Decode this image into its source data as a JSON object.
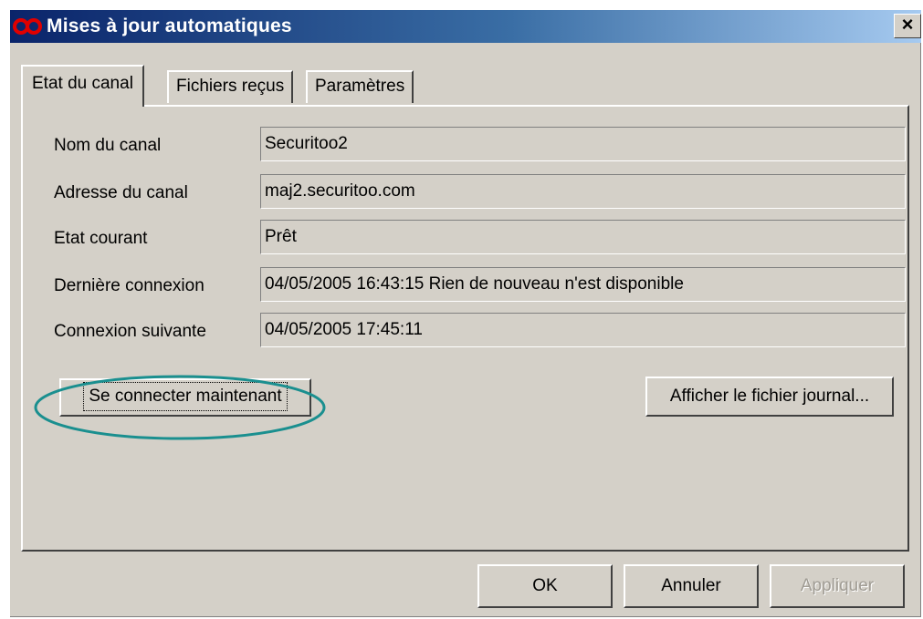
{
  "window": {
    "title": "Mises à jour automatiques",
    "close_label": "×"
  },
  "tabs": [
    {
      "label": "Etat du canal",
      "active": true
    },
    {
      "label": "Fichiers reçus",
      "active": false
    },
    {
      "label": "Paramètres",
      "active": false
    }
  ],
  "fields": [
    {
      "label": "Nom du canal",
      "value": "Securitoo2"
    },
    {
      "label": "Adresse du canal",
      "value": "maj2.securitoo.com"
    },
    {
      "label": "Etat courant",
      "value": "Prêt"
    },
    {
      "label": "Dernière connexion",
      "value": "04/05/2005 16:43:15  Rien de nouveau n'est disponible"
    },
    {
      "label": "Connexion suivante",
      "value": "04/05/2005 17:45:11"
    }
  ],
  "buttons": {
    "connect_now": "Se connecter maintenant",
    "show_log": "Afficher le fichier journal...",
    "ok": "OK",
    "cancel": "Annuler",
    "apply": "Appliquer"
  },
  "colors": {
    "highlight_ellipse": "#1a8f8f",
    "title_gradient_start": "#0a246a",
    "title_gradient_end": "#a6caf0",
    "app_icon": "#e00000"
  }
}
